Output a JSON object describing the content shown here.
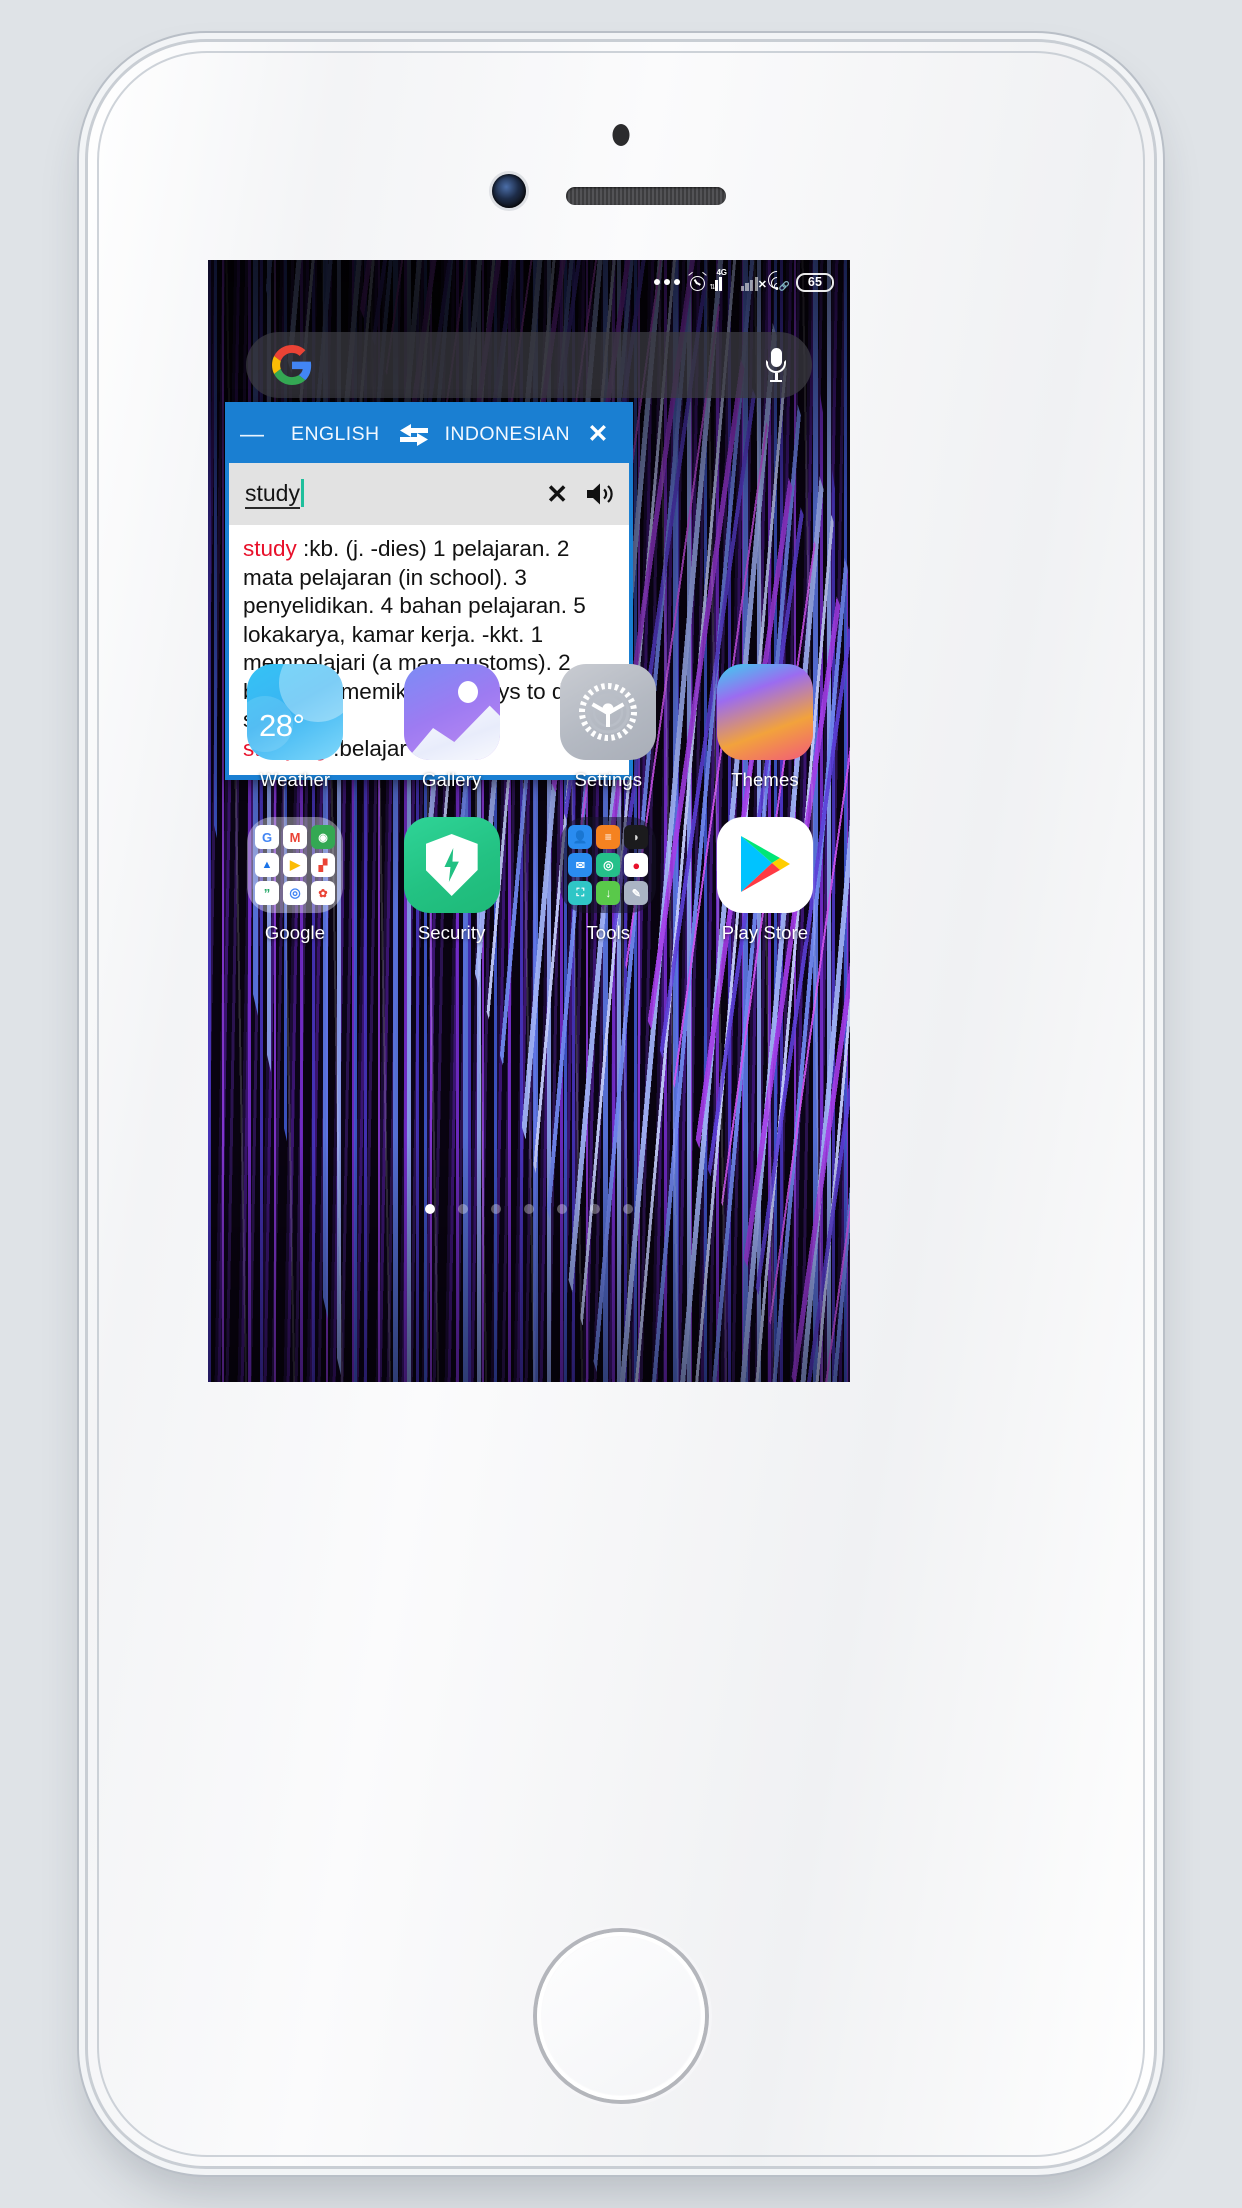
{
  "device": {
    "frame_color": "#f7f8fa",
    "page_background": "#dfe3e7"
  },
  "statusbar": {
    "more_icon": "more-dots-icon",
    "alarm_icon": "alarm-clock-icon",
    "sim1_label": "4G",
    "sim2_state": "no-service",
    "wifi_icon": "wifi-icon",
    "battery_level": "65"
  },
  "search_widget": {
    "logo": "google-g-logo",
    "placeholder": "",
    "value": "",
    "mic_icon": "microphone-icon"
  },
  "translate_dialog": {
    "accent_color": "#1a7fd2",
    "minimize_label": "—",
    "source_language": "ENGLISH",
    "swap_icon": "swap-arrows-icon",
    "target_language": "INDONESIAN",
    "close_label": "✕",
    "input": {
      "value": "study",
      "placeholder": "",
      "clear_label": "✕",
      "speaker_icon": "volume-speaker-icon"
    },
    "result": {
      "entries": [
        {
          "headword": "study",
          "definition": " :kb. (j. -dies) 1 pelajaran. 2 mata pelajaran (in school). 3 penyelidikan. 4 bahan pelajaran. 5 lokakarya, kamar kerja. -kkt. 1 mempelajari (a map, customs). 2 belajar. 3 memikirkan (ways to do s.t.)."
        },
        {
          "headword": "studying",
          "definition": " :belajar"
        }
      ],
      "headword_color": "#e8102a"
    }
  },
  "home_screen": {
    "rows": [
      {
        "apps": [
          {
            "label": "Weather",
            "icon": "weather-icon",
            "badge": "28°"
          },
          {
            "label": "Gallery",
            "icon": "gallery-icon"
          },
          {
            "label": "Settings",
            "icon": "settings-gear-icon"
          },
          {
            "label": "Themes",
            "icon": "themes-brush-icon"
          }
        ]
      },
      {
        "apps": [
          {
            "label": "Google",
            "icon": "google-folder-icon"
          },
          {
            "label": "Security",
            "icon": "security-shield-icon"
          },
          {
            "label": "Tools",
            "icon": "tools-folder-icon"
          },
          {
            "label": "Play Store",
            "icon": "play-store-icon"
          }
        ]
      }
    ],
    "page_indicator": {
      "total": 7,
      "active": 1
    }
  }
}
